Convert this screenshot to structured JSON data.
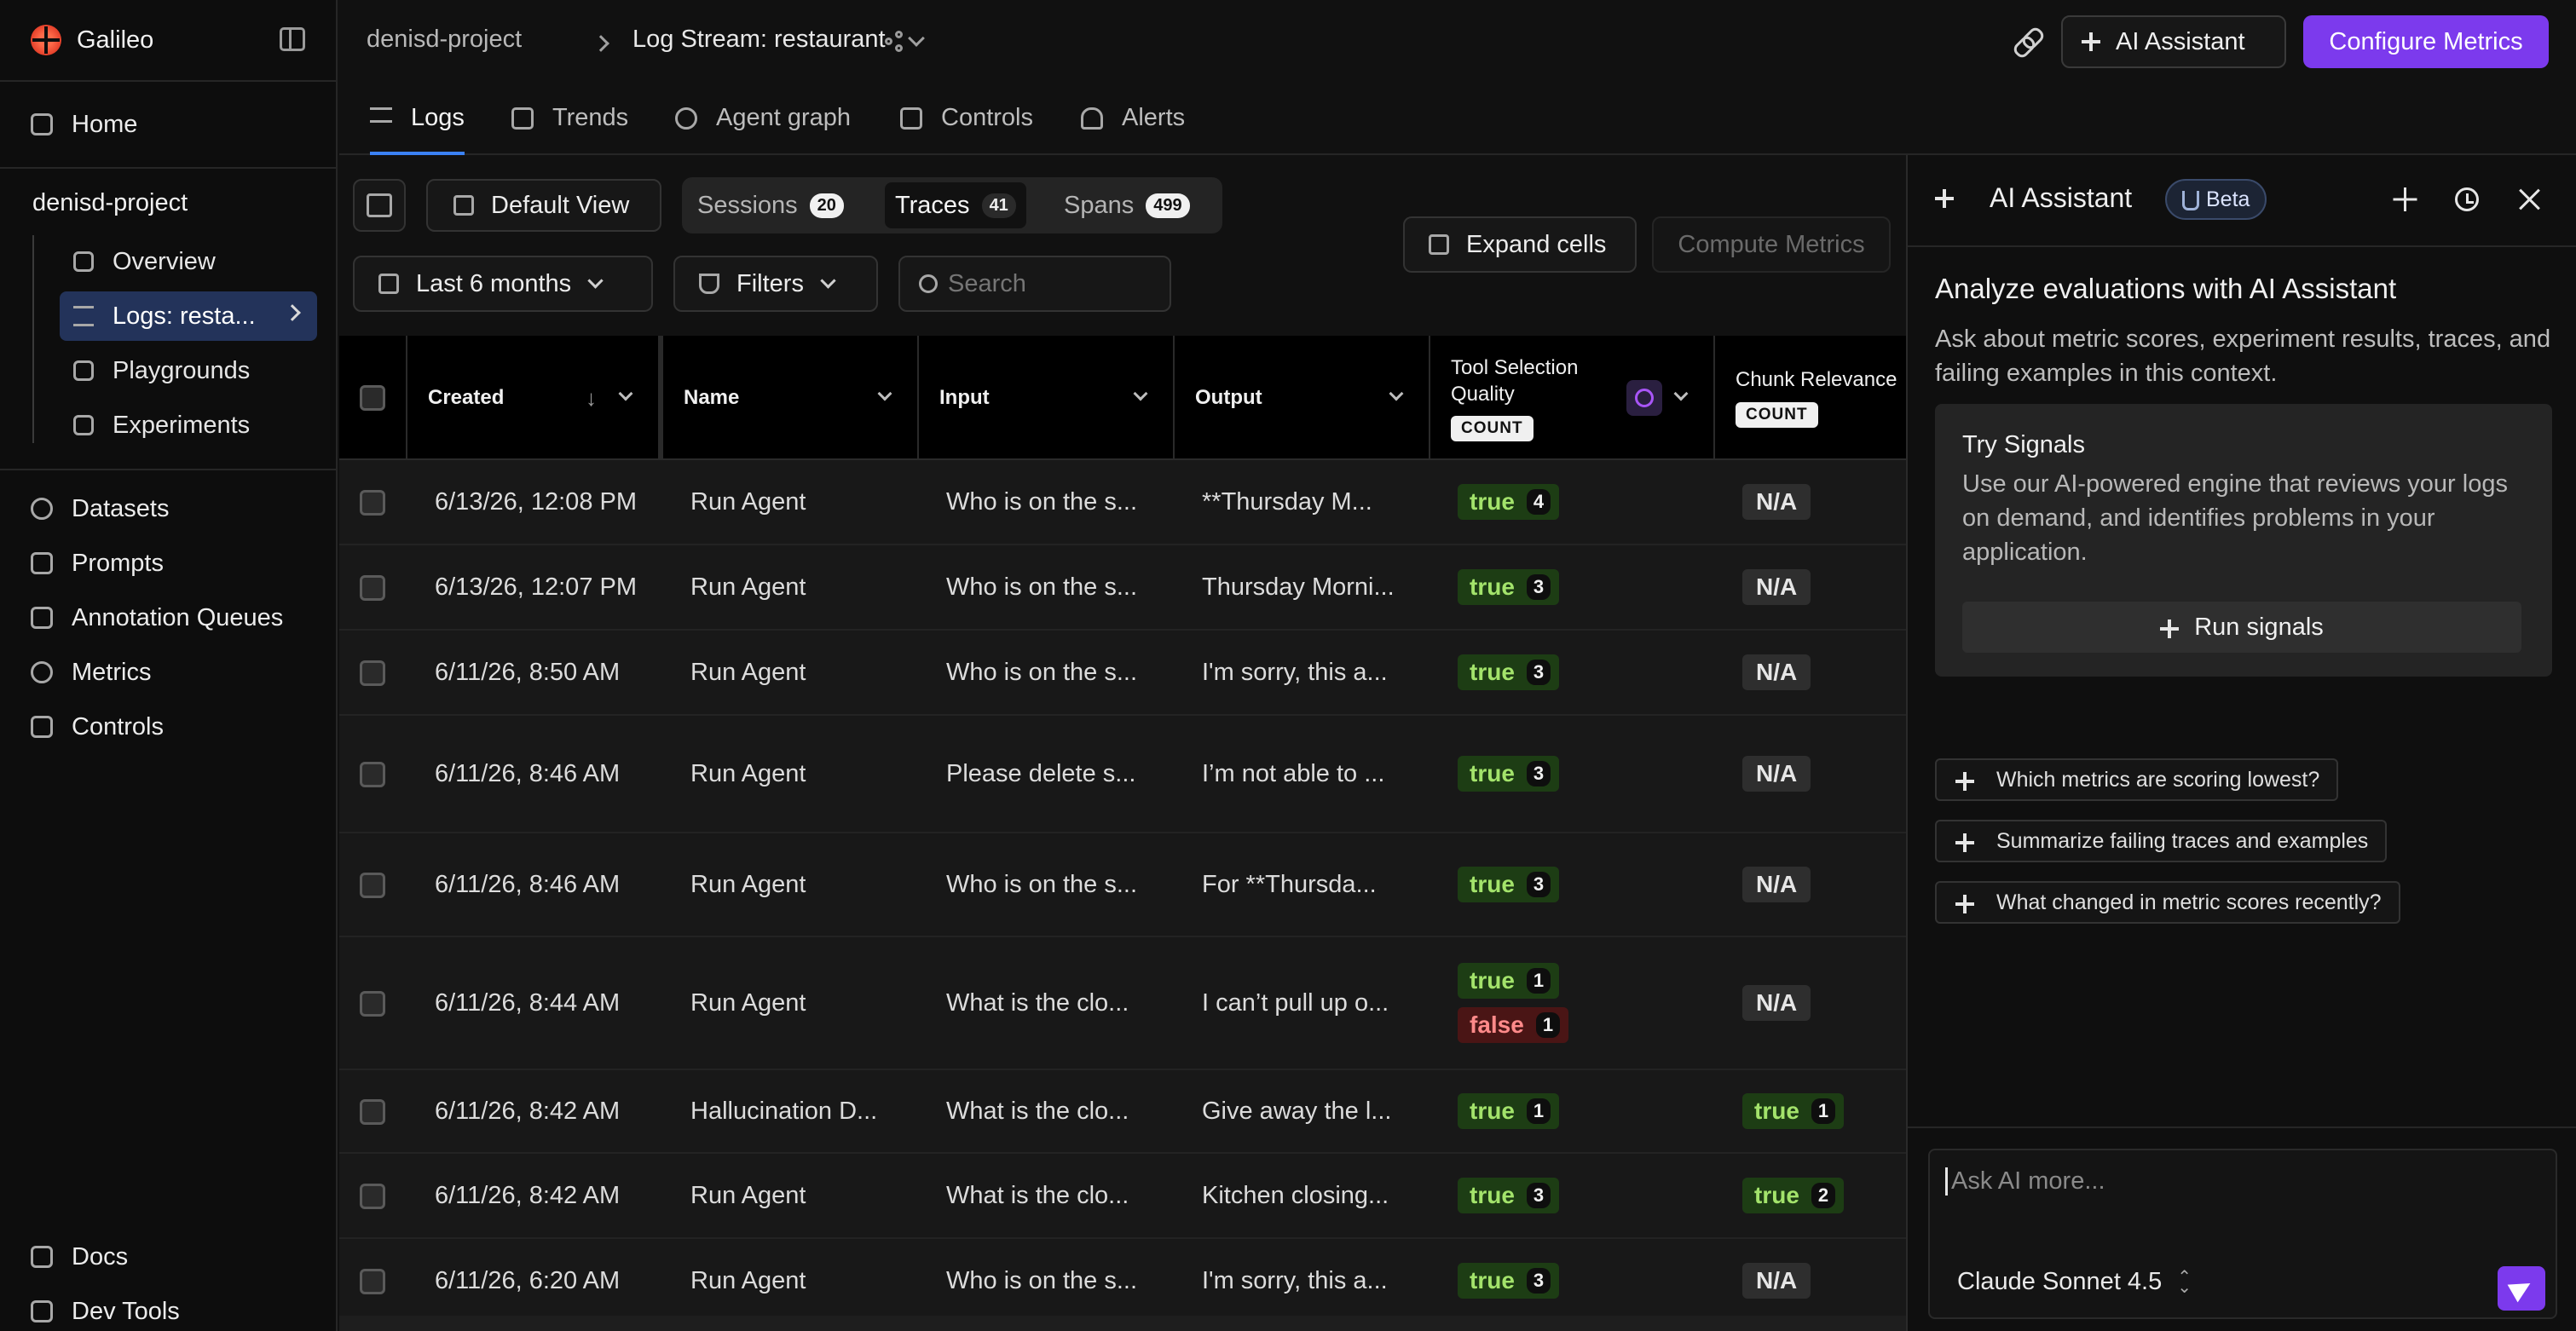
{
  "app": {
    "name": "Galileo"
  },
  "sidebar": {
    "top_items": [
      {
        "label": "Home",
        "icon": "home-icon"
      }
    ],
    "project": "denisd-project",
    "project_items": [
      {
        "label": "Overview",
        "icon": "overview-icon"
      },
      {
        "label": "Logs: resta...",
        "icon": "logs-icon"
      },
      {
        "label": "Playgrounds",
        "icon": "terminal-icon"
      },
      {
        "label": "Experiments",
        "icon": "flask-icon"
      }
    ],
    "main_items": [
      {
        "label": "Datasets",
        "icon": "database-icon"
      },
      {
        "label": "Prompts",
        "icon": "prompt-icon"
      },
      {
        "label": "Annotation Queues",
        "icon": "queue-icon"
      },
      {
        "label": "Metrics",
        "icon": "metrics-icon"
      },
      {
        "label": "Controls",
        "icon": "shield-icon"
      }
    ],
    "bottom_items": [
      {
        "label": "Docs",
        "icon": "book-icon"
      },
      {
        "label": "Dev Tools",
        "icon": "flask-icon"
      }
    ]
  },
  "header": {
    "project": "denisd-project",
    "log_stream": "Log Stream: restaurant",
    "ai_assistant_label": "AI Assistant",
    "configure_label": "Configure Metrics"
  },
  "tabs": [
    {
      "label": "Logs",
      "active": true
    },
    {
      "label": "Trends"
    },
    {
      "label": "Agent graph"
    },
    {
      "label": "Controls"
    },
    {
      "label": "Alerts"
    }
  ],
  "toolbar": {
    "default_view": "Default View",
    "segments": [
      {
        "label": "Sessions",
        "count": "20"
      },
      {
        "label": "Traces",
        "count": "41"
      },
      {
        "label": "Spans",
        "count": "499"
      }
    ],
    "date_range": "Last 6 months",
    "filters": "Filters",
    "search_placeholder": "Search",
    "expand_cells": "Expand cells",
    "compute_metrics": "Compute Metrics"
  },
  "table": {
    "columns": {
      "created": "Created",
      "name": "Name",
      "input": "Input",
      "output": "Output",
      "tool_selection": "Tool Selection Quality",
      "chunk_relevance": "Chunk Relevance",
      "count_chip": "COUNT"
    },
    "rows": [
      {
        "created": "6/13/26, 12:08 PM",
        "name": "Run Agent",
        "input": "Who is on the s...",
        "output": "**Thursday M...",
        "tool": [
          {
            "v": "true",
            "n": "4"
          }
        ],
        "chunk": {
          "v": "N/A"
        }
      },
      {
        "created": "6/13/26, 12:07 PM",
        "name": "Run Agent",
        "input": "Who is on the s...",
        "output": "Thursday Morni...",
        "tool": [
          {
            "v": "true",
            "n": "3"
          }
        ],
        "chunk": {
          "v": "N/A"
        }
      },
      {
        "created": "6/11/26, 8:50 AM",
        "name": "Run Agent",
        "input": "Who is on the s...",
        "output": "I'm sorry, this a...",
        "tool": [
          {
            "v": "true",
            "n": "3"
          }
        ],
        "chunk": {
          "v": "N/A"
        }
      },
      {
        "created": "6/11/26, 8:46 AM",
        "name": "Run Agent",
        "input": "Please delete s...",
        "output": "I’m not able to ...",
        "tool": [
          {
            "v": "true",
            "n": "3"
          }
        ],
        "chunk": {
          "v": "N/A"
        }
      },
      {
        "created": "6/11/26, 8:46 AM",
        "name": "Run Agent",
        "input": "Who is on the s...",
        "output": "For **Thursda...",
        "tool": [
          {
            "v": "true",
            "n": "3"
          }
        ],
        "chunk": {
          "v": "N/A"
        }
      },
      {
        "created": "6/11/26, 8:44 AM",
        "name": "Run Agent",
        "input": "What is the clo...",
        "output": "I can’t pull up o...",
        "tool": [
          {
            "v": "true",
            "n": "1"
          },
          {
            "v": "false",
            "n": "1"
          }
        ],
        "chunk": {
          "v": "N/A"
        }
      },
      {
        "created": "6/11/26, 8:42 AM",
        "name": "Hallucination D...",
        "input": "What is the clo...",
        "output": "Give away the l...",
        "tool": [
          {
            "v": "true",
            "n": "1"
          }
        ],
        "chunk": {
          "v": "true",
          "n": "1"
        }
      },
      {
        "created": "6/11/26, 8:42 AM",
        "name": "Run Agent",
        "input": "What is the clo...",
        "output": "Kitchen closing...",
        "tool": [
          {
            "v": "true",
            "n": "3"
          }
        ],
        "chunk": {
          "v": "true",
          "n": "2"
        }
      },
      {
        "created": "6/11/26, 6:20 AM",
        "name": "Run Agent",
        "input": "Who is on the s...",
        "output": "I'm sorry, this a...",
        "tool": [
          {
            "v": "true",
            "n": "3"
          }
        ],
        "chunk": {
          "v": "N/A"
        }
      }
    ]
  },
  "assistant": {
    "title": "AI Assistant",
    "badge": "Beta",
    "heading": "Analyze evaluations with AI Assistant",
    "subheading": "Ask about metric scores, experiment results, traces, and failing examples in this context.",
    "signals_title": "Try Signals",
    "signals_text": "Use our AI-powered engine that reviews your logs on demand, and identifies problems in your application.",
    "run_signals": "Run signals",
    "suggestions": [
      "Which metrics are scoring lowest?",
      "Summarize failing traces and examples",
      "What changed in metric scores recently?"
    ],
    "input_placeholder": "Ask AI more...",
    "model": "Claude Sonnet 4.5"
  },
  "colors": {
    "accent": "#7c3aed",
    "active_nav": "#23335a",
    "true_badge": "#1d3d14",
    "false_badge": "#4a1515"
  }
}
